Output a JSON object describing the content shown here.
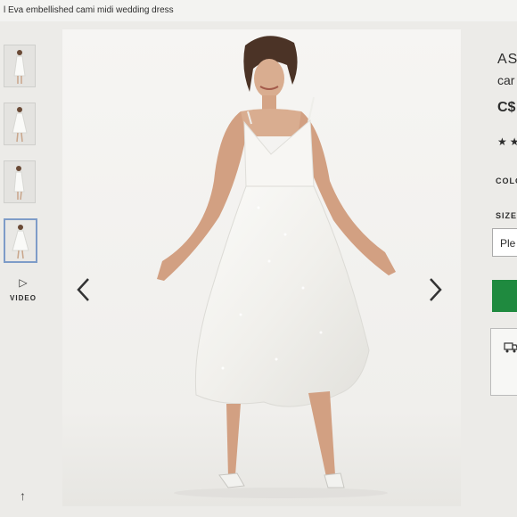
{
  "breadcrumb": {
    "title": "l Eva embellished cami midi wedding dress"
  },
  "thumbnails": [
    {
      "alt": "front"
    },
    {
      "alt": "front-2"
    },
    {
      "alt": "side"
    },
    {
      "alt": "back"
    }
  ],
  "video": {
    "label": "VIDEO"
  },
  "product": {
    "brand_partial": "AS",
    "name_partial": "car",
    "price_partial": "C$",
    "stars": "★★",
    "colour_label": "COLO",
    "size_label": "SIZE",
    "size_placeholder": "Ple"
  },
  "colors": {
    "accent_green": "#1f8a3f",
    "thumb_active_border": "#7e9cc8"
  }
}
